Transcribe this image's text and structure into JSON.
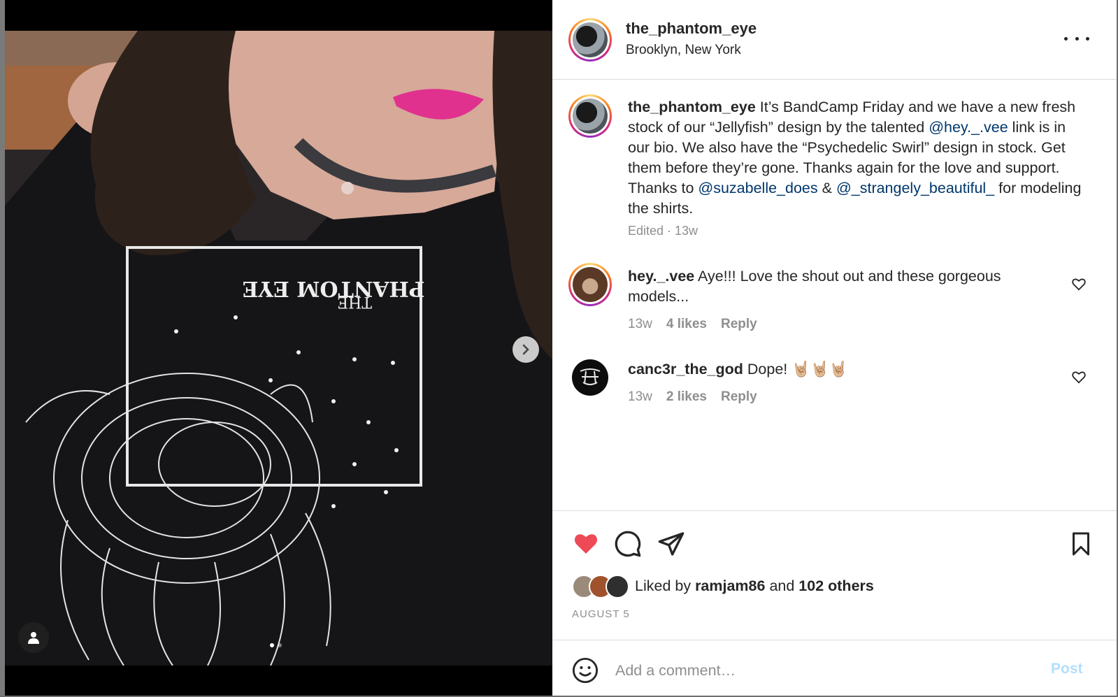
{
  "post": {
    "author": "the_phantom_eye",
    "location": "Brooklyn, New York",
    "caption": {
      "username": "the_phantom_eye",
      "part1": " It’s BandCamp Friday and we have a new fresh stock of our “Jellyfish” design by the talented ",
      "mention1": "@hey._.vee",
      "part2": " link is in our bio. We also have the “Psychedelic Swirl” design in stock. Get them before they’re gone. Thanks again for the love and support. Thanks to ",
      "mention2": "@suzabelle_does",
      "part3": " & ",
      "mention3": "@_strangely_beautiful_",
      "part4": " for modeling the shirts.",
      "meta": "Edited · 13w"
    },
    "comments": [
      {
        "username": "hey._.vee",
        "text": " Aye!!! Love the shout out and these gorgeous models...",
        "time": "13w",
        "likes": "4 likes",
        "reply": "Reply"
      },
      {
        "username": "canc3r_the_god",
        "text": " Dope! 🤘🏼🤘🏼🤘🏼",
        "time": "13w",
        "likes": "2 likes",
        "reply": "Reply"
      }
    ],
    "likes": {
      "prefix": "Liked by ",
      "user": "ramjam86",
      "middle": " and ",
      "others": "102 others"
    },
    "date": "AUGUST 5",
    "comment_input": {
      "placeholder": "Add a comment…"
    },
    "post_label": "Post",
    "photo_print": {
      "line1": "THE",
      "line2": "PHANTOM EYE"
    }
  },
  "icons": {
    "more": "more-options-icon",
    "like": "heart-filled-icon",
    "comment": "comment-icon",
    "share": "share-icon",
    "save": "bookmark-icon",
    "emoji": "emoji-icon",
    "next": "chevron-right-icon",
    "tag": "user-tag-icon"
  },
  "colors": {
    "like_red": "#ed4956",
    "link_blue": "#00376b",
    "post_disabled": "#b2dffc",
    "muted": "#8e8e8e"
  }
}
